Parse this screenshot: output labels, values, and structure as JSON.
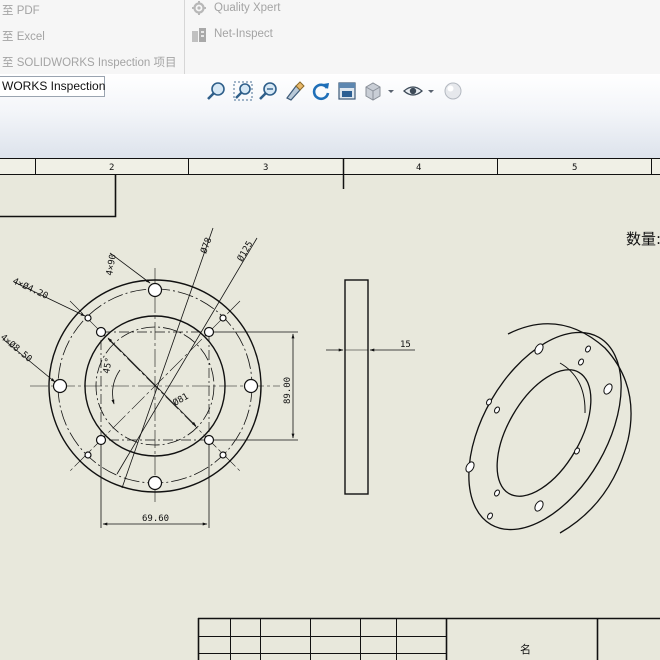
{
  "ribbon": {
    "export_items": [
      {
        "prefix": "至",
        "label": "PDF"
      },
      {
        "prefix": "至",
        "label": "Excel"
      },
      {
        "prefix": "至",
        "label": "SOLIDWORKS Inspection 项目"
      }
    ],
    "addins": [
      {
        "label": "Quality Xpert",
        "icon": "gear-icon"
      },
      {
        "label": "Net-Inspect",
        "icon": "building-icon"
      }
    ]
  },
  "tab": {
    "label": "WORKS Inspection"
  },
  "toolbar": {
    "icons": [
      "zoom-to-fit-icon",
      "zoom-to-area-icon",
      "zoom-in-out-icon",
      "pan-icon",
      "rotate-icon",
      "view-orientation-icon",
      "display-style-icon",
      "hide-show-icon",
      "appearance-icon"
    ]
  },
  "drawing": {
    "zone_labels": [
      "2",
      "3",
      "4",
      "5"
    ],
    "quantity_label": "数量:",
    "dims": {
      "hole_small": "4×Ø4.20",
      "hole_large": "4×Ø8.50",
      "bolt_circle": "Ø78",
      "outer_diameter": "Ø125",
      "inner_diameter": "Ø81",
      "angle_top": "4×90",
      "angle": "45°",
      "height": "89.00",
      "width": "69.60",
      "thickness": "15"
    },
    "title_block_text": "名"
  },
  "colors": {
    "sheet_bg": "#e8e8dc",
    "ribbon_bg": "#f6f6f6",
    "line": "#111111"
  }
}
